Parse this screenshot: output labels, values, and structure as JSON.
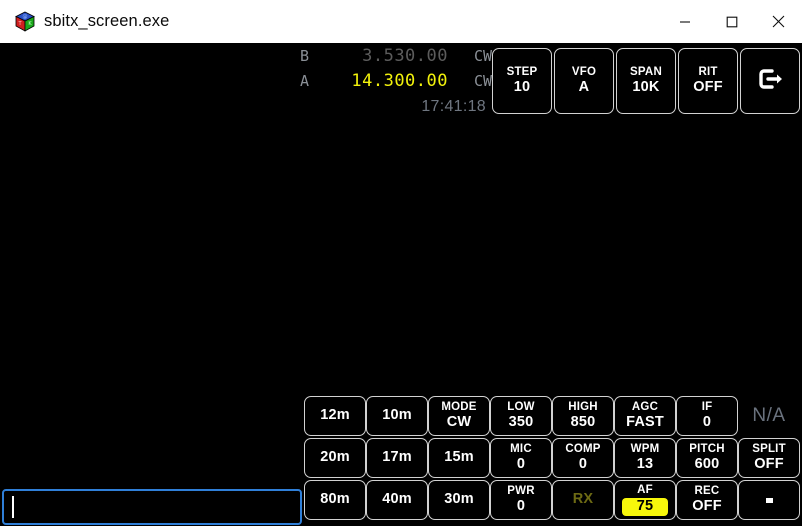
{
  "window": {
    "title": "sbitx_screen.exe",
    "icon": "app-cube-icon",
    "controls": {
      "minimize": "minimize-icon",
      "maximize": "maximize-icon",
      "close": "close-icon"
    }
  },
  "vfo": {
    "b": {
      "label": "B",
      "frequency": "3.530.00",
      "mode": "CW"
    },
    "a": {
      "label": "A",
      "frequency": "14.300.00",
      "mode": "CW"
    },
    "clock": "17:41:18",
    "active_color": "#f2f20c",
    "inactive_color": "#5c5c5c",
    "label_color": "#8a8f96"
  },
  "top_controls": [
    {
      "name": "step",
      "title": "STEP",
      "value": "10"
    },
    {
      "name": "vfo",
      "title": "VFO",
      "value": "A"
    },
    {
      "name": "span",
      "title": "SPAN",
      "value": "10K"
    },
    {
      "name": "rit",
      "title": "RIT",
      "value": "OFF"
    },
    {
      "name": "exit",
      "title": "",
      "value": "",
      "icon": "exit-icon"
    }
  ],
  "grid": {
    "row1": [
      {
        "name": "band-12m",
        "title": "",
        "value": "12m",
        "type": "single"
      },
      {
        "name": "band-10m",
        "title": "",
        "value": "10m",
        "type": "single"
      },
      {
        "name": "mode",
        "title": "MODE",
        "value": "CW",
        "type": "pair"
      },
      {
        "name": "low",
        "title": "LOW",
        "value": "350",
        "type": "pair"
      },
      {
        "name": "high",
        "title": "HIGH",
        "value": "850",
        "type": "pair"
      },
      {
        "name": "agc",
        "title": "AGC",
        "value": "FAST",
        "type": "pair"
      },
      {
        "name": "if",
        "title": "IF",
        "value": "0",
        "type": "pair"
      },
      {
        "name": "na",
        "title": "",
        "value": "N/A",
        "type": "plain"
      }
    ],
    "row2": [
      {
        "name": "band-20m",
        "title": "",
        "value": "20m",
        "type": "single"
      },
      {
        "name": "band-17m",
        "title": "",
        "value": "17m",
        "type": "single"
      },
      {
        "name": "band-15m",
        "title": "",
        "value": "15m",
        "type": "single"
      },
      {
        "name": "mic",
        "title": "MIC",
        "value": "0",
        "type": "pair"
      },
      {
        "name": "comp",
        "title": "COMP",
        "value": "0",
        "type": "pair"
      },
      {
        "name": "wpm",
        "title": "WPM",
        "value": "13",
        "type": "pair"
      },
      {
        "name": "pitch",
        "title": "PITCH",
        "value": "600",
        "type": "pair"
      },
      {
        "name": "split",
        "title": "SPLIT",
        "value": "OFF",
        "type": "pair"
      }
    ],
    "row3": [
      {
        "name": "band-80m",
        "title": "",
        "value": "80m",
        "type": "single"
      },
      {
        "name": "band-40m",
        "title": "",
        "value": "40m",
        "type": "single"
      },
      {
        "name": "band-30m",
        "title": "",
        "value": "30m",
        "type": "single"
      },
      {
        "name": "pwr",
        "title": "PWR",
        "value": "0",
        "type": "pair"
      },
      {
        "name": "rx",
        "title": "",
        "value": "RX",
        "type": "dim"
      },
      {
        "name": "af",
        "title": "AF",
        "value": "75",
        "type": "highlight"
      },
      {
        "name": "rec",
        "title": "REC",
        "value": "OFF",
        "type": "pair"
      },
      {
        "name": "dash",
        "title": "",
        "value": "-",
        "type": "dash"
      }
    ]
  },
  "command_input": {
    "value": "",
    "placeholder": ""
  },
  "colors": {
    "screen_background": "#000000",
    "button_border": "#d2d2d2",
    "button_text": "#ffffff",
    "highlight_yellow": "#f7f70b",
    "input_border": "#2f7fd8",
    "dim_text": "#6d6a14",
    "na_text": "#6a727e"
  }
}
